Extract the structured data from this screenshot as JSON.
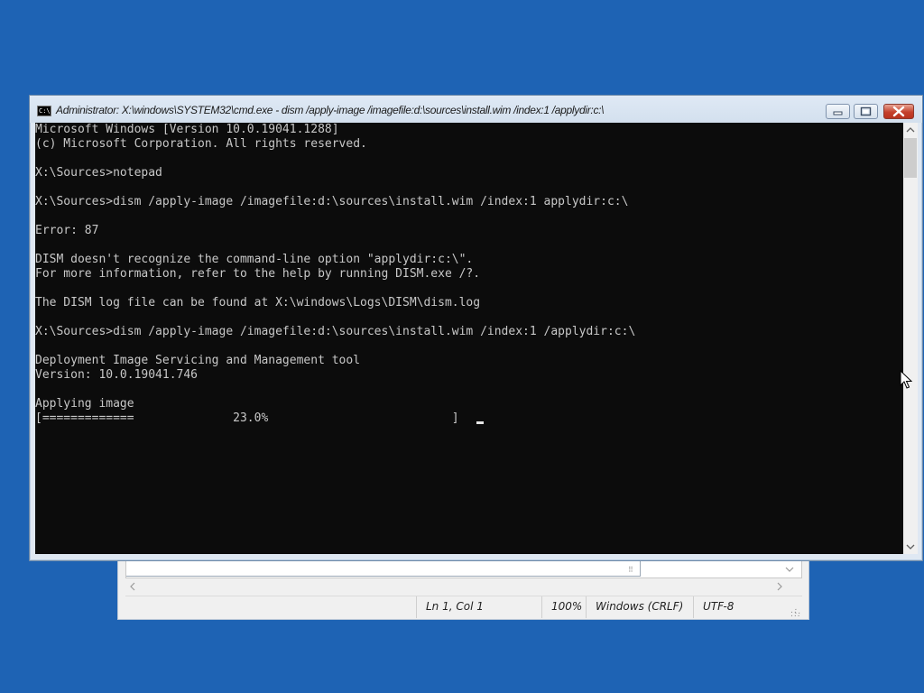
{
  "notepad": {
    "status": {
      "position": "Ln 1, Col 1",
      "zoom": "100%",
      "line_ending": "Windows (CRLF)",
      "encoding": "UTF-8"
    }
  },
  "cmd": {
    "title": "Administrator: X:\\windows\\SYSTEM32\\cmd.exe - dism  /apply-image /imagefile:d:\\sources\\install.wim /index:1 /applydir:c:\\",
    "icon_text": "C:\\",
    "console_lines": [
      "Microsoft Windows [Version 10.0.19041.1288]",
      "(c) Microsoft Corporation. All rights reserved.",
      "",
      "X:\\Sources>notepad",
      "",
      "X:\\Sources>dism /apply-image /imagefile:d:\\sources\\install.wim /index:1 applydir:c:\\",
      "",
      "Error: 87",
      "",
      "DISM doesn't recognize the command-line option \"applydir:c:\\\".",
      "For more information, refer to the help by running DISM.exe /?.",
      "",
      "The DISM log file can be found at X:\\windows\\Logs\\DISM\\dism.log",
      "",
      "X:\\Sources>dism /apply-image /imagefile:d:\\sources\\install.wim /index:1 /applydir:c:\\",
      "",
      "Deployment Image Servicing and Management tool",
      "Version: 10.0.19041.746",
      "",
      "Applying image",
      "[=============              23.0%                          ]"
    ]
  },
  "icons": {
    "app_icon": "cmd-icon",
    "minimize": "minimize-icon",
    "maximize": "maximize-icon",
    "close": "close-icon",
    "pointer": "mouse-pointer-icon"
  }
}
